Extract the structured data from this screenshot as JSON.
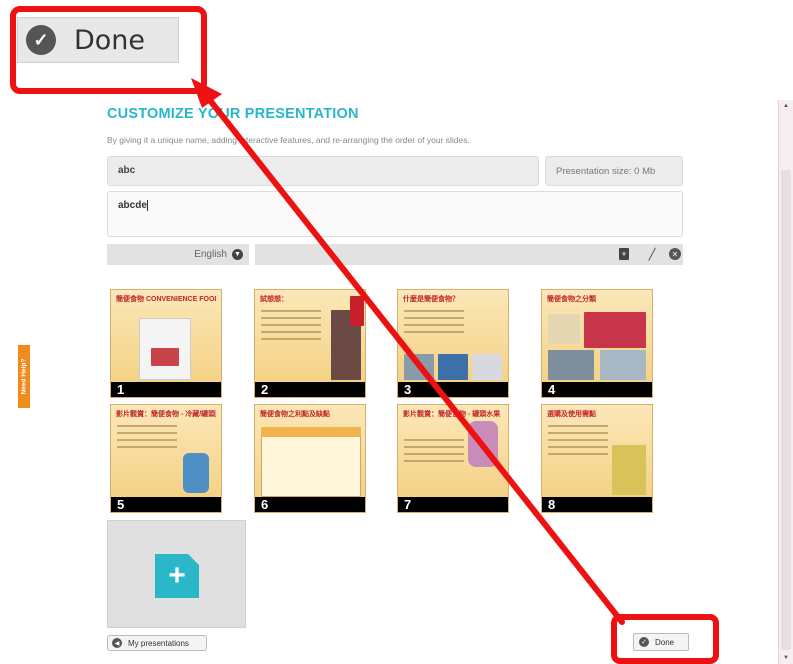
{
  "callout": {
    "done_label": "Done"
  },
  "page": {
    "title": "CUSTOMIZE YOUR PRESENTATION",
    "subtitle": "By giving it a unique name, adding interactive features, and re-arranging the order of your slides."
  },
  "form": {
    "name_value": "abc",
    "size_label": "Presentation size: 0 Mb",
    "description_value": "abcde",
    "language": "English"
  },
  "slides": [
    {
      "num": "1",
      "title": "簡便食物 CONVENIENCE FOOD"
    },
    {
      "num": "2",
      "title": "試想想："
    },
    {
      "num": "3",
      "title": "什麼是簡便食物？"
    },
    {
      "num": "4",
      "title": "簡便食物之分類"
    },
    {
      "num": "5",
      "title": "影片觀賞：簡便食物 - 冷藏/罐頭蔬菜"
    },
    {
      "num": "6",
      "title": "簡便食物之利點及缺點"
    },
    {
      "num": "7",
      "title": "影片觀賞：簡便食物 - 罐頭水果"
    },
    {
      "num": "8",
      "title": "選購及使用需點"
    }
  ],
  "footer": {
    "my_presentations": "My presentations",
    "done": "Done"
  },
  "help": {
    "label": "Need Help?"
  },
  "colors": {
    "accent": "#29b6cc",
    "highlight": "#ee1111",
    "help": "#f08c1e"
  }
}
